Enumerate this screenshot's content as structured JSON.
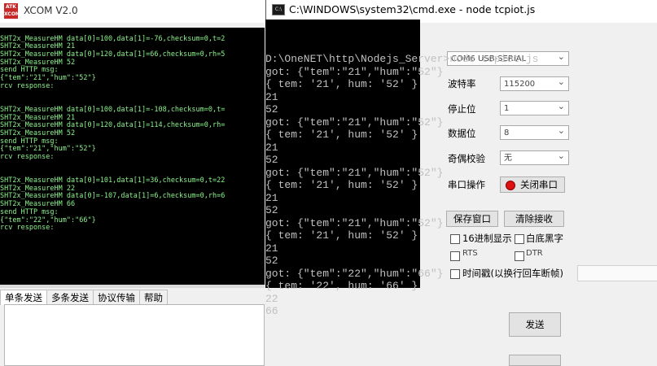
{
  "xcom": {
    "logo_text": "ATK XCOM",
    "title": "XCOM V2.0",
    "terminal_lines": [
      "",
      "SHT2x_MeasureHM data[0]=100,data[1]=-76,checksum=0,t=2",
      "SHT2x_MeasureHM 21",
      "SHT2x_MeasureHM data[0]=120,data[1]=66,checksum=0,rh=5",
      "SHT2x_MeasureHM 52",
      "send HTTP msg:",
      "{\"tem\":\"21\",\"hum\":\"52\"}",
      "rcv response:",
      "",
      "",
      "SHT2x_MeasureHM data[0]=100,data[1]=-108,checksum=0,t=",
      "SHT2x_MeasureHM 21",
      "SHT2x_MeasureHM data[0]=120,data[1]=114,checksum=0,rh=",
      "SHT2x_MeasureHM 52",
      "send HTTP msg:",
      "{\"tem\":\"21\",\"hum\":\"52\"}",
      "rcv response:",
      "",
      "",
      "SHT2x_MeasureHM data[0]=101,data[1]=36,checksum=0,t=22",
      "SHT2x_MeasureHM 22",
      "SHT2x_MeasureHM data[0]=-107,data[1]=6,checksum=0,rh=6",
      "SHT2x_MeasureHM 66",
      "send HTTP msg:",
      "{\"tem\":\"22\",\"hum\":\"66\"}",
      "rcv response:"
    ],
    "tabs": [
      "单条发送",
      "多条发送",
      "协议传输",
      "帮助"
    ],
    "right_panel": {
      "port_value": "COM6 USB-SERIAL",
      "baud_label": "波特率",
      "baud_value": "115200",
      "stop_label": "停止位",
      "stop_value": "1",
      "data_label": "数据位",
      "data_value": "8",
      "parity_label": "奇偶校验",
      "parity_value": "无",
      "serial_op_label": "串口操作",
      "close_port": "关闭串口",
      "save_window": "保存窗口",
      "clear_recv": "清除接收",
      "hex_display": "16进制显示",
      "white_bg": "白底黑字",
      "rts": "RTS",
      "dtr": "DTR",
      "timestamp": "时间戳(以换行回车断帧)",
      "send": "发送"
    }
  },
  "cmd": {
    "title": "C:\\WINDOWS\\system32\\cmd.exe - node  tcpiot.js",
    "lines": [
      "D:\\OneNET\\http\\Nodejs_Server>node tcpiot.js",
      "got: {\"tem\":\"21\",\"hum\":\"52\"}",
      "{ tem: '21', hum: '52' }",
      "21",
      "52",
      "got: {\"tem\":\"21\",\"hum\":\"52\"}",
      "{ tem: '21', hum: '52' }",
      "21",
      "52",
      "got: {\"tem\":\"21\",\"hum\":\"52\"}",
      "{ tem: '21', hum: '52' }",
      "21",
      "52",
      "got: {\"tem\":\"21\",\"hum\":\"52\"}",
      "{ tem: '21', hum: '52' }",
      "21",
      "52",
      "got: {\"tem\":\"22\",\"hum\":\"66\"}",
      "{ tem: '22', hum: '66' }",
      "22",
      "66"
    ]
  }
}
